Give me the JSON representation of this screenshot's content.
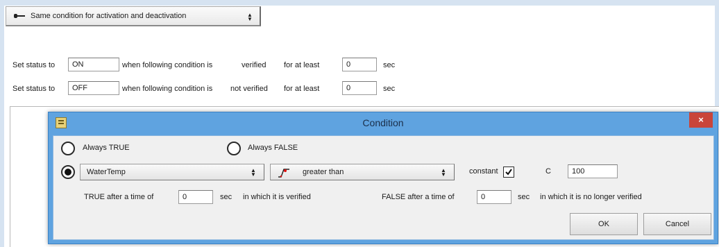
{
  "mode_select": {
    "value": "Same condition for activation and deactivation",
    "icon": "dash-icon"
  },
  "status_rows": [
    {
      "label_set": "Set status to",
      "status_value": "ON",
      "label_when": "when following condition is",
      "label_state": "verified",
      "label_for": "for at least",
      "seconds_value": "0",
      "label_unit": "sec"
    },
    {
      "label_set": "Set status to",
      "status_value": "OFF",
      "label_when": "when following condition is",
      "label_state": "not verified",
      "label_for": "for at least",
      "seconds_value": "0",
      "label_unit": "sec"
    }
  ],
  "dialog": {
    "title": "Condition",
    "close": "×",
    "always_true": "Always TRUE",
    "always_false": "Always FALSE",
    "selected_option": "condition",
    "variable": "WaterTemp",
    "operator": "greater than",
    "constant_label": "constant",
    "constant_checked": true,
    "unit": "C",
    "threshold": "100",
    "true_after_label": "TRUE after a time of",
    "true_after_value": "0",
    "true_after_unit": "sec",
    "true_after_suffix": "in which it is verified",
    "false_after_label": "FALSE after a time of",
    "false_after_value": "0",
    "false_after_unit": "sec",
    "false_after_suffix": "in which it is no longer verified",
    "ok": "OK",
    "cancel": "Cancel"
  },
  "colors": {
    "titlebar": "#5fa3e0",
    "close": "#c9453a",
    "client": "#f0f0f0"
  }
}
